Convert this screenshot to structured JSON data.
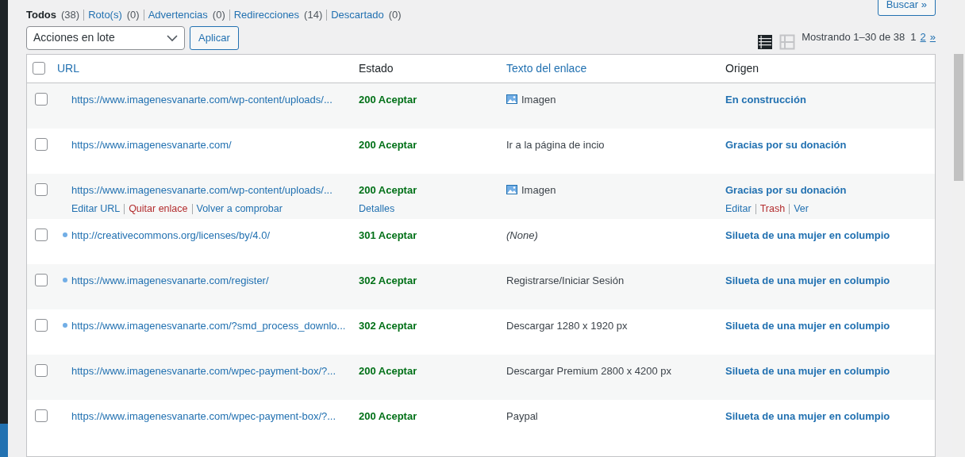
{
  "filters": [
    {
      "label": "Todos",
      "count": "(38)",
      "selected": true
    },
    {
      "label": "Roto(s)",
      "count": "(0)",
      "selected": false
    },
    {
      "label": "Advertencias",
      "count": "(0)",
      "selected": false
    },
    {
      "label": "Redirecciones",
      "count": "(14)",
      "selected": false
    },
    {
      "label": "Descartado",
      "count": "(0)",
      "selected": false
    }
  ],
  "search_button": "Buscar »",
  "bulk_actions": {
    "value": "Acciones en lote"
  },
  "apply_button": "Aplicar",
  "view_modes": [
    {
      "kind": "compact",
      "selected": true
    },
    {
      "kind": "extended",
      "selected": false
    }
  ],
  "pagination": {
    "summary": "Mostrando 1–30 de 38",
    "pages": [
      {
        "label": "1",
        "selected": true
      },
      {
        "label": "2",
        "selected": false
      }
    ],
    "next": "»"
  },
  "select_all_checked": false,
  "columns": [
    {
      "label": "URL",
      "sortable": true
    },
    {
      "label": "Estado",
      "sortable": false
    },
    {
      "label": "Texto del enlace",
      "sortable": true
    },
    {
      "label": "Origen",
      "sortable": false
    }
  ],
  "rows": [
    {
      "checked": false,
      "url": "https://www.imagenesvanarte.com/wp-content/uploads/...",
      "redirect": false,
      "status": "200 Aceptar",
      "kind": "image",
      "link_text": "Imagen",
      "source": "En construcción"
    },
    {
      "checked": false,
      "url": "https://www.imagenesvanarte.com/",
      "redirect": false,
      "status": "200 Aceptar",
      "kind": "text",
      "link_text": "Ir a la página de incio",
      "source": "Gracias por su donación"
    },
    {
      "checked": false,
      "url": "https://www.imagenesvanarte.com/wp-content/uploads/...",
      "redirect": false,
      "status": "200 Aceptar",
      "kind": "image",
      "link_text": "Imagen",
      "source": "Gracias por su donación",
      "url_actions": [
        {
          "label": "Editar URL",
          "kind": "normal"
        },
        {
          "label": "Quitar enlace",
          "kind": "danger"
        },
        {
          "label": "Volver a comprobar",
          "kind": "normal"
        }
      ],
      "status_actions": [
        {
          "label": "Detalles",
          "kind": "normal"
        }
      ],
      "source_actions": [
        {
          "label": "Editar",
          "kind": "normal"
        },
        {
          "label": "Trash",
          "kind": "danger"
        },
        {
          "label": "Ver",
          "kind": "normal"
        }
      ]
    },
    {
      "checked": false,
      "url": "http://creativecommons.org/licenses/by/4.0/",
      "redirect": true,
      "status": "301 Aceptar",
      "kind": "none",
      "link_text": "(None)",
      "source": "Silueta de una mujer en columpio"
    },
    {
      "checked": false,
      "url": "https://www.imagenesvanarte.com/register/",
      "redirect": true,
      "status": "302 Aceptar",
      "kind": "text",
      "link_text": "Registrarse/Iniciar Sesión",
      "source": "Silueta de una mujer en columpio"
    },
    {
      "checked": false,
      "url": "https://www.imagenesvanarte.com/?smd_process_downlo...",
      "redirect": true,
      "status": "302 Aceptar",
      "kind": "text",
      "link_text": "Descargar 1280 x 1920 px",
      "source": "Silueta de una mujer en columpio"
    },
    {
      "checked": false,
      "url": "https://www.imagenesvanarte.com/wpec-payment-box/?...",
      "redirect": false,
      "status": "200 Aceptar",
      "kind": "text",
      "link_text": "Descargar Premium 2800 x 4200 px",
      "source": "Silueta de una mujer en columpio"
    },
    {
      "checked": false,
      "url": "https://www.imagenesvanarte.com/wpec-payment-box/?...",
      "redirect": false,
      "status": "200 Aceptar",
      "kind": "text",
      "link_text": "Paypal",
      "source": "Silueta de una mujer en columpio"
    }
  ]
}
